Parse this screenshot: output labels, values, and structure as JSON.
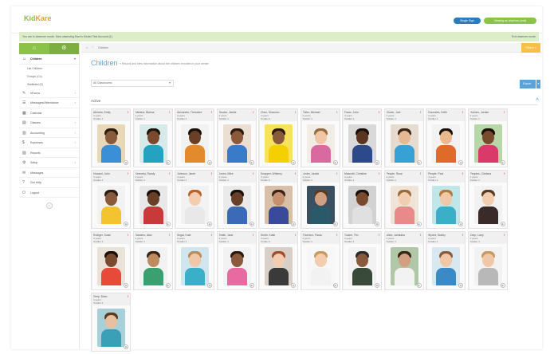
{
  "app": {
    "logo_main": "Kid",
    "logo_accent": "Kare"
  },
  "header": {
    "single_sign": "Single Sign",
    "observer_btn": "Viewing as observer (exit)"
  },
  "banner": {
    "message": "You are in observer mode. Now observing Kare's Kinder Test Account (1)",
    "exit": "Exit observer mode"
  },
  "sidebar": {
    "tab_home_icon": "home-icon",
    "tab_settings_icon": "gear-icon",
    "items": [
      {
        "label": "Children",
        "icon": "child-icon",
        "chevron": "▾",
        "active": true,
        "sub": [
          "List Children",
          "Groups (Co)",
          "Waitlisted (E)"
        ]
      },
      {
        "label": "eForms",
        "icon": "form-icon",
        "chevron": "›"
      },
      {
        "label": "Messages/Attendance",
        "icon": "attendance-icon",
        "chevron": "›"
      },
      {
        "label": "Calendar",
        "icon": "calendar-icon",
        "chevron": ""
      },
      {
        "label": "Classes",
        "icon": "classes-icon",
        "chevron": "›"
      },
      {
        "label": "Accounting",
        "icon": "accounting-icon",
        "chevron": "›"
      },
      {
        "label": "Expenses",
        "icon": "expenses-icon",
        "chevron": "›"
      },
      {
        "label": "Reports",
        "icon": "reports-icon",
        "chevron": ""
      },
      {
        "label": "Setup",
        "icon": "setup-icon",
        "chevron": "›"
      },
      {
        "label": "Messages",
        "icon": "messages-icon",
        "chevron": ""
      },
      {
        "label": "Get Help",
        "icon": "help-icon",
        "chevron": ""
      },
      {
        "label": "Logout",
        "icon": "logout-icon",
        "chevron": ""
      }
    ]
  },
  "breadcrumb": {
    "current": "Children"
  },
  "filters_btn": "Filters »",
  "page": {
    "title": "Children",
    "subtitle": "» Record and view information about the children enrolled in your center.",
    "class_select": "All Classrooms",
    "export_label": "Export",
    "section": "Active"
  },
  "children": [
    {
      "name": "Abiraha, Emily",
      "age": "4 years",
      "room": "Toddler 4",
      "skin": "#8a5a3c",
      "hair": "#2b1a10",
      "shirt": "#3b8fd6",
      "bg": "#e9d8b8"
    },
    {
      "name": "Abiraha, Bianca",
      "age": "4 years",
      "room": "Toddler 4",
      "skin": "#7a4a2e",
      "hair": "#1e120a",
      "shirt": "#23a3c0",
      "bg": "#d7e9e8"
    },
    {
      "name": "Alexander, Theodore",
      "age": "4 years",
      "room": "Toddler 4",
      "skin": "#6a3f28",
      "hair": "#1a0f08",
      "shirt": "#e38b2c",
      "bg": "#f2f2f2"
    },
    {
      "name": "Brooks, Jackie",
      "age": "4 years",
      "room": "Toddler 4",
      "skin": "#8b5a3a",
      "hair": "#2a1a10",
      "shirt": "#3a7bc9",
      "bg": "#eadfd2"
    },
    {
      "name": "Chen, Shannon",
      "age": "4 years",
      "room": "Toddler 4",
      "skin": "#8a5a3c",
      "hair": "#2b1a10",
      "shirt": "#f5d000",
      "bg": "#f7e25a"
    },
    {
      "name": "Fidler, Michael",
      "age": "4 years",
      "room": "Toddler 4",
      "skin": "#efc6a6",
      "hair": "#9b6a3a",
      "shirt": "#d86aa0",
      "bg": "#f2ece6"
    },
    {
      "name": "Franz, John",
      "age": "4 years",
      "room": "Toddler 4",
      "skin": "#5a3520",
      "hair": "#1a0f08",
      "shirt": "#2c4a8a",
      "bg": "#d9d9d9"
    },
    {
      "name": "Glover, Joel",
      "age": "4 years",
      "room": "Toddler 4",
      "skin": "#e7b894",
      "hair": "#3a2415",
      "shirt": "#37a1d6",
      "bg": "#e6dbcf"
    },
    {
      "name": "Gonzales, Keith",
      "age": "4 years",
      "room": "Toddler 4",
      "skin": "#e9b98e",
      "hair": "#1a1008",
      "shirt": "#e06a2a",
      "bg": "#f2f2f2"
    },
    {
      "name": "Holmes, Jordan",
      "age": "4 years",
      "room": "Toddler 4",
      "skin": "#7a4a2e",
      "hair": "#1a0f08",
      "shirt": "#d93a6a",
      "bg": "#b8d7a8"
    },
    {
      "name": "Howard, John",
      "age": "4 years",
      "room": "Toddler 4",
      "skin": "#8a5a3c",
      "hair": "#2b1a10",
      "shirt": "#f4c430",
      "bg": "#f2f2f2"
    },
    {
      "name": "Kennedy, Randy",
      "age": "4 years",
      "room": "Toddler 4",
      "skin": "#6a3f28",
      "hair": "#1a0f08",
      "shirt": "#c83a3a",
      "bg": "#e8e8e8"
    },
    {
      "name": "Johnson, Janet",
      "age": "4 years",
      "room": "Toddler 4",
      "skin": "#f2cdb0",
      "hair": "#b8622c",
      "shirt": "#e8e8e8",
      "bg": "#f2f2f2"
    },
    {
      "name": "Jones, Mike",
      "age": "4 years",
      "room": "Toddler 4",
      "skin": "#6a3f28",
      "hair": "#1a0f08",
      "shirt": "#3a6ab8",
      "bg": "#eaeaea"
    },
    {
      "name": "Knapper, Whitney",
      "age": "4 years",
      "room": "Toddler 4",
      "skin": "#c49070",
      "hair": "#3a2415",
      "shirt": "#3a4a9a",
      "bg": "#d8c0a8"
    },
    {
      "name": "Linder, Jackie",
      "age": "4 years",
      "room": "Toddler 4",
      "skin": "#d0a080",
      "hair": "#5a3a20",
      "shirt": "#2a5a6a",
      "bg": "#3a5060"
    },
    {
      "name": "Mascotti, Christine",
      "age": "4 years",
      "room": "Toddler 4",
      "skin": "#7a4a2e",
      "hair": "#1a0f08",
      "shirt": "#e0e0e0",
      "bg": "#d2d2d2"
    },
    {
      "name": "People, Rose",
      "age": "4 years",
      "room": "Toddler 4",
      "skin": "#f2cdb0",
      "hair": "#9a6a3a",
      "shirt": "#e88a8a",
      "bg": "#f0e4d8"
    },
    {
      "name": "People, Paul",
      "age": "4 years",
      "room": "Toddler 4",
      "skin": "#f0c8a8",
      "hair": "#b07a40",
      "shirt": "#3ab0c8",
      "bg": "#bfe6e8"
    },
    {
      "name": "Peoples, Chelsea",
      "age": "4 years",
      "room": "Toddler 4",
      "skin": "#f2cdb0",
      "hair": "#5a3a20",
      "shirt": "#3a2a2a",
      "bg": "#f2f2f2"
    },
    {
      "name": "Rodiger, Susie",
      "age": "4 years",
      "room": "Toddler 4",
      "skin": "#7a4a2e",
      "hair": "#1a0f08",
      "shirt": "#e84a3a",
      "bg": "#e8e2d8"
    },
    {
      "name": "Sanders, Alan",
      "age": "4 years",
      "room": "Toddler 4",
      "skin": "#c08a60",
      "hair": "#3a2415",
      "shirt": "#3aa070",
      "bg": "#f2f2f2"
    },
    {
      "name": "Segal, Kate",
      "age": "4 years",
      "room": "Toddler 4",
      "skin": "#f0c8a8",
      "hair": "#c08a50",
      "shirt": "#3ab0c8",
      "bg": "#cfe6ee"
    },
    {
      "name": "Smith, Jane",
      "age": "4 years",
      "room": "Toddler 4",
      "skin": "#8a5a3c",
      "hair": "#2b1a10",
      "shirt": "#e86aa0",
      "bg": "#f2f2f2"
    },
    {
      "name": "Smith, Katie",
      "age": "4 years",
      "room": "Toddler 4",
      "skin": "#f2cdb0",
      "hair": "#a84a2a",
      "shirt": "#3a3a3a",
      "bg": "#d8d0c8"
    },
    {
      "name": "Thornton, Paula",
      "age": "4 years",
      "room": "Toddler 4",
      "skin": "#f2cdb0",
      "hair": "#c89a60",
      "shirt": "#f2f2f2",
      "bg": "#f7f7f7"
    },
    {
      "name": "Tucker, Tim",
      "age": "4 years",
      "room": "Toddler 4",
      "skin": "#8a5a3c",
      "hair": "#2a2a2a",
      "shirt": "#3a4a3a",
      "bg": "#f2f2f2"
    },
    {
      "name": "Ware, Jaimiaha",
      "age": "4 years",
      "room": "Toddler 4",
      "skin": "#d0a080",
      "hair": "#3a2415",
      "shirt": "#f2f2f2",
      "bg": "#b0c8a8"
    },
    {
      "name": "Wyche, Bobby",
      "age": "4 years",
      "room": "Toddler 4",
      "skin": "#f0c8a8",
      "hair": "#8a5a3a",
      "shirt": "#3a8ac8",
      "bg": "#d8e8f0"
    },
    {
      "name": "Zeep, Larry",
      "age": "4 years",
      "room": "Toddler 4",
      "skin": "#f0c8a8",
      "hair": "#c89a60",
      "shirt": "#b8b8b8",
      "bg": "#f2f2f2"
    },
    {
      "name": "Zeep, Brian",
      "age": "4 years",
      "room": "Toddler 4",
      "skin": "#e8c0a0",
      "hair": "#5a3a20",
      "shirt": "#3aa0b8",
      "bg": "#a8d0d8"
    }
  ]
}
